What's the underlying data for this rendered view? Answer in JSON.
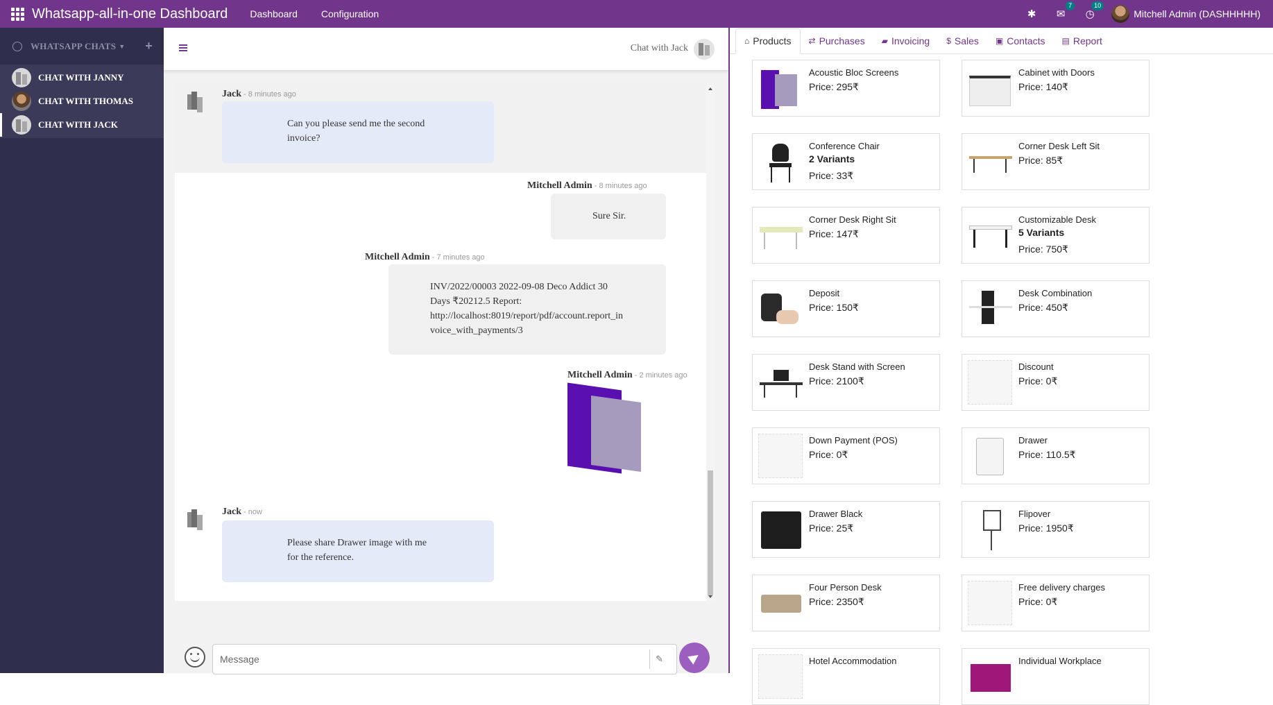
{
  "topbar": {
    "title": "Whatsapp-all-in-one Dashboard",
    "menu": [
      "Dashboard",
      "Configuration"
    ],
    "badges": {
      "chat": "7",
      "activity": "10"
    },
    "user": "Mitchell Admin (DASHHHHH)"
  },
  "sidebar": {
    "header": "WHATSAPP CHATS",
    "chats": [
      {
        "label": "CHAT WITH JANNY"
      },
      {
        "label": "CHAT WITH THOMAS"
      },
      {
        "label": "CHAT WITH JACK"
      }
    ]
  },
  "chat": {
    "title": "Chat with Jack",
    "messages": [
      {
        "sender": "Jack",
        "ago": " - 8 minutes ago",
        "lines": [
          "Can you please send me the second",
          "invoice?"
        ]
      },
      {
        "sender": "Mitchell Admin",
        "ago": " - 8 minutes ago",
        "lines": [
          "Sure Sir."
        ]
      },
      {
        "sender": "Mitchell Admin",
        "ago": " - 7 minutes ago",
        "lines": [
          "INV/2022/00003 2022-09-08 Deco Addict 30",
          "Days ₹20212.5 Report:",
          "http://localhost:8019/report/pdf/account.report_in",
          "voice_with_payments/3"
        ]
      },
      {
        "sender": "Mitchell Admin",
        "ago": " - 2 minutes ago",
        "lines": []
      },
      {
        "sender": "Jack",
        "ago": " - now",
        "lines": [
          "Please share Drawer image with me",
          "for the reference."
        ]
      }
    ],
    "input_placeholder": "Message"
  },
  "tabs": [
    "Products",
    "Purchases",
    "Invoicing",
    "Sales",
    "Contacts",
    "Report"
  ],
  "products": [
    {
      "name": "Acoustic Bloc Screens",
      "variants": "",
      "price": "Price: 295₹"
    },
    {
      "name": "Cabinet with Doors",
      "variants": "",
      "price": "Price: 140₹"
    },
    {
      "name": "Conference Chair",
      "variants": "2 Variants",
      "price": "Price: 33₹"
    },
    {
      "name": "Corner Desk Left Sit",
      "variants": "",
      "price": "Price: 85₹"
    },
    {
      "name": "Corner Desk Right Sit",
      "variants": "",
      "price": "Price: 147₹"
    },
    {
      "name": "Customizable Desk",
      "variants": "5 Variants",
      "price": "Price: 750₹"
    },
    {
      "name": "Deposit",
      "variants": "",
      "price": "Price: 150₹"
    },
    {
      "name": "Desk Combination",
      "variants": "",
      "price": "Price: 450₹"
    },
    {
      "name": "Desk Stand with Screen",
      "variants": "",
      "price": "Price: 2100₹"
    },
    {
      "name": "Discount",
      "variants": "",
      "price": "Price: 0₹"
    },
    {
      "name": "Down Payment (POS)",
      "variants": "",
      "price": "Price: 0₹"
    },
    {
      "name": "Drawer",
      "variants": "",
      "price": "Price: 110.5₹"
    },
    {
      "name": "Drawer Black",
      "variants": "",
      "price": "Price: 25₹"
    },
    {
      "name": "Flipover",
      "variants": "",
      "price": "Price: 1950₹"
    },
    {
      "name": "Four Person Desk",
      "variants": "",
      "price": "Price: 2350₹"
    },
    {
      "name": "Free delivery charges",
      "variants": "",
      "price": "Price: 0₹"
    },
    {
      "name": "Hotel Accommodation",
      "variants": "",
      "price": ""
    },
    {
      "name": "Individual Workplace",
      "variants": "",
      "price": ""
    }
  ],
  "colors": {
    "brand": "#71368b",
    "sidebar": "#2f2e4c",
    "incoming_bubble": "#e4eaf7",
    "send_button": "#9c5fc0"
  }
}
